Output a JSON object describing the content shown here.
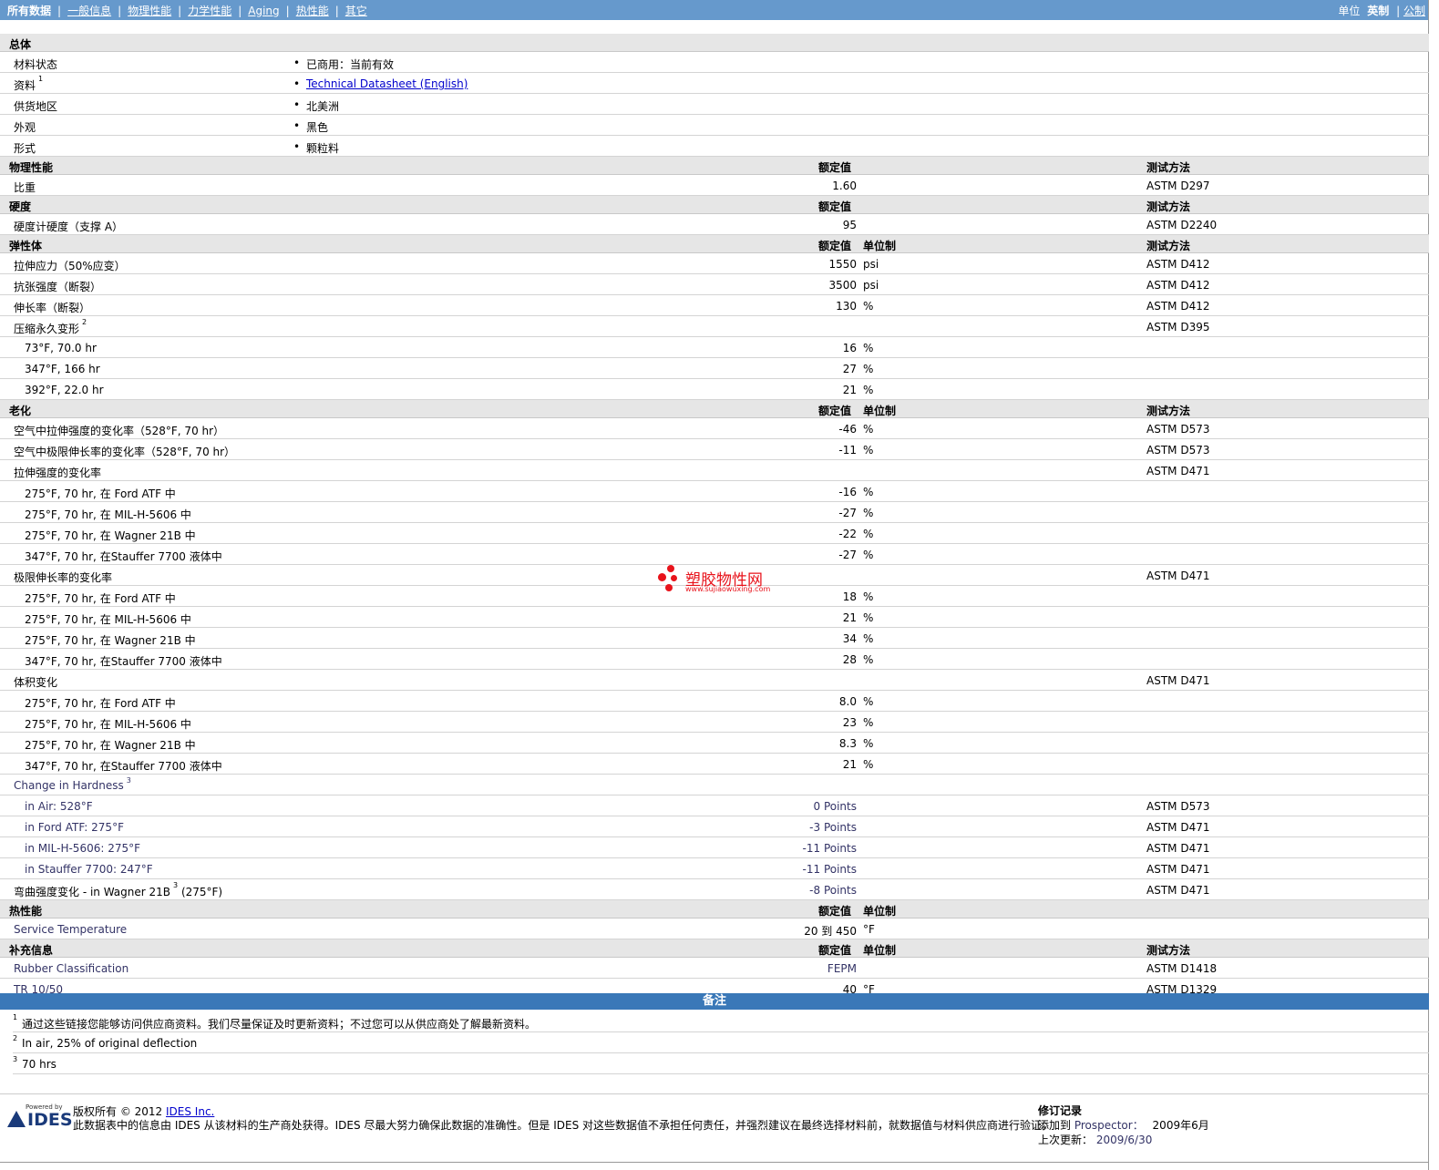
{
  "nav": {
    "items": [
      "所有数据",
      "一般信息",
      "物理性能",
      "力学性能",
      "Aging",
      "热性能",
      "其它"
    ],
    "units_label": "单位",
    "units_current": "英制",
    "units_other": "公制"
  },
  "sections": {
    "general": {
      "title": "总体",
      "rows": [
        {
          "name": "材料状态",
          "value": "已商用：当前有效"
        },
        {
          "name": "资料",
          "sup": "1",
          "value": "Technical Datasheet (English)"
        },
        {
          "name": "供货地区",
          "value": "北美洲"
        },
        {
          "name": "外观",
          "value": "黑色"
        },
        {
          "name": "形式",
          "value": "颗粒料"
        }
      ]
    },
    "physical": {
      "title": "物理性能",
      "col_value": "额定值",
      "col_method": "测试方法",
      "rows": [
        {
          "name": "比重",
          "value": "1.60",
          "method": "ASTM D297"
        }
      ]
    },
    "hardness": {
      "title": "硬度",
      "col_value": "额定值",
      "col_method": "测试方法",
      "rows": [
        {
          "name": "硬度计硬度（支撑 A）",
          "value": "95",
          "method": "ASTM D2240"
        }
      ]
    },
    "elastomer": {
      "title": "弹性体",
      "col_value": "额定值",
      "col_unit": "单位制",
      "col_method": "测试方法",
      "rows": [
        {
          "name": "拉伸应力（50%应变）",
          "value": "1550",
          "unit": "psi",
          "method": "ASTM D412"
        },
        {
          "name": "抗张强度（断裂）",
          "value": "3500",
          "unit": "psi",
          "method": "ASTM D412"
        },
        {
          "name": "伸长率（断裂）",
          "value": "130",
          "unit": "%",
          "method": "ASTM D412"
        },
        {
          "name": "压缩永久变形",
          "sup": "2",
          "method": "ASTM D395"
        },
        {
          "name": "73°F, 70.0 hr",
          "value": "16",
          "unit": "%",
          "sub": true
        },
        {
          "name": "347°F, 166 hr",
          "value": "27",
          "unit": "%",
          "sub": true
        },
        {
          "name": "392°F, 22.0 hr",
          "value": "21",
          "unit": "%",
          "sub": true
        }
      ]
    },
    "aging": {
      "title": "老化",
      "col_value": "额定值",
      "col_unit": "单位制",
      "col_method": "测试方法",
      "rows": [
        {
          "name": "空气中拉伸强度的变化率（528°F, 70 hr）",
          "value": "-46",
          "unit": "%",
          "method": "ASTM D573"
        },
        {
          "name": "空气中极限伸长率的变化率（528°F, 70 hr）",
          "value": "-11",
          "unit": "%",
          "method": "ASTM D573"
        },
        {
          "name": "拉伸强度的变化率",
          "method": "ASTM D471"
        },
        {
          "name": "275°F, 70 hr, 在 Ford ATF 中",
          "value": "-16",
          "unit": "%",
          "sub": true
        },
        {
          "name": "275°F, 70 hr, 在 MIL-H-5606 中",
          "value": "-27",
          "unit": "%",
          "sub": true
        },
        {
          "name": "275°F, 70 hr, 在 Wagner 21B 中",
          "value": "-22",
          "unit": "%",
          "sub": true
        },
        {
          "name": "347°F, 70 hr, 在Stauffer 7700 液体中",
          "value": "-27",
          "unit": "%",
          "sub": true
        },
        {
          "name": "极限伸长率的变化率",
          "method": "ASTM D471"
        },
        {
          "name": "275°F, 70 hr, 在 Ford ATF 中",
          "value": "18",
          "unit": "%",
          "sub": true
        },
        {
          "name": "275°F, 70 hr, 在 MIL-H-5606 中",
          "value": "21",
          "unit": "%",
          "sub": true
        },
        {
          "name": "275°F, 70 hr, 在 Wagner 21B 中",
          "value": "34",
          "unit": "%",
          "sub": true
        },
        {
          "name": "347°F, 70 hr, 在Stauffer 7700 液体中",
          "value": "28",
          "unit": "%",
          "sub": true
        },
        {
          "name": "体积变化",
          "method": "ASTM D471"
        },
        {
          "name": "275°F, 70 hr, 在 Ford ATF 中",
          "value": "8.0",
          "unit": "%",
          "sub": true
        },
        {
          "name": "275°F, 70 hr, 在 MIL-H-5606 中",
          "value": "23",
          "unit": "%",
          "sub": true
        },
        {
          "name": "275°F, 70 hr, 在 Wagner 21B 中",
          "value": "8.3",
          "unit": "%",
          "sub": true
        },
        {
          "name": "347°F, 70 hr, 在Stauffer 7700 液体中",
          "value": "21",
          "unit": "%",
          "sub": true
        },
        {
          "name": "Change in Hardness",
          "sup": "3",
          "purple": true
        },
        {
          "name": "in Air: 528°F",
          "value": "0 Points",
          "method": "ASTM D573",
          "sub": true,
          "purple": true,
          "valpurple": true
        },
        {
          "name": "in Ford ATF: 275°F",
          "value": "-3 Points",
          "method": "ASTM D471",
          "sub": true,
          "purple": true,
          "valpurple": true
        },
        {
          "name": "in MIL-H-5606: 275°F",
          "value": "-11 Points",
          "method": "ASTM D471",
          "sub": true,
          "purple": true,
          "valpurple": true
        },
        {
          "name": "in Stauffer 7700: 247°F",
          "value": "-11 Points",
          "method": "ASTM D471",
          "sub": true,
          "purple": true,
          "valpurple": true
        },
        {
          "name": "弯曲强度变化  - in Wagner 21B",
          "sup": "3",
          "suffix": " (275°F)",
          "value": "-8 Points",
          "method": "ASTM D471",
          "valpurple": true
        }
      ]
    },
    "thermal": {
      "title": "热性能",
      "col_value": "额定值",
      "col_unit": "单位制",
      "rows": [
        {
          "name": "Service Temperature",
          "value": "20 到  450",
          "unit": "°F",
          "purple": true
        }
      ]
    },
    "supplement": {
      "title": "补充信息",
      "col_value": "额定值",
      "col_unit": "单位制",
      "col_method": "测试方法",
      "rows": [
        {
          "name": "Rubber Classification",
          "value": "FEPM",
          "method": "ASTM D1418",
          "purple": true,
          "valpurple": true
        },
        {
          "name": "TR 10/50",
          "value": "40",
          "unit": "°F",
          "method": "ASTM D1329",
          "purple": true
        }
      ]
    }
  },
  "notes": {
    "title": "备注",
    "items": [
      {
        "sup": "1",
        "text": "通过这些链接您能够访问供应商资料。我们尽量保证及时更新资料；不过您可以从供应商处了解最新资料。"
      },
      {
        "sup": "2",
        "text": "In air, 25% of original deflection"
      },
      {
        "sup": "3",
        "text": "70 hrs"
      }
    ]
  },
  "watermark": {
    "text": "塑胶物性网",
    "url": "www.sujiaowuxing.com"
  },
  "footer": {
    "logo_powered": "Powered by",
    "logo_word": "IDES",
    "copyright": "版权所有  © 2012",
    "company_link": "IDES Inc.",
    "disclaimer": "此数据表中的信息由  IDES 从该材料的生产商处获得。IDES 尽最大努力确保此数据的准确性。但是  IDES 对这些数据值不承担任何责任，并强烈建议在最终选择材料前，就数据值与材料供应商进行验证。",
    "revision_title": "修订记录",
    "added_label": "添加到",
    "added_site": "Prospector：",
    "added_date": "2009年6月",
    "updated_label": "上次更新：",
    "updated_date": "2009/6/30"
  },
  "colors": {
    "topbar": "#6699cc",
    "notes_bar": "#3a78b8",
    "header_row": "#e6e6e6",
    "link": "#0000cc",
    "watermark": "#e8131b"
  }
}
